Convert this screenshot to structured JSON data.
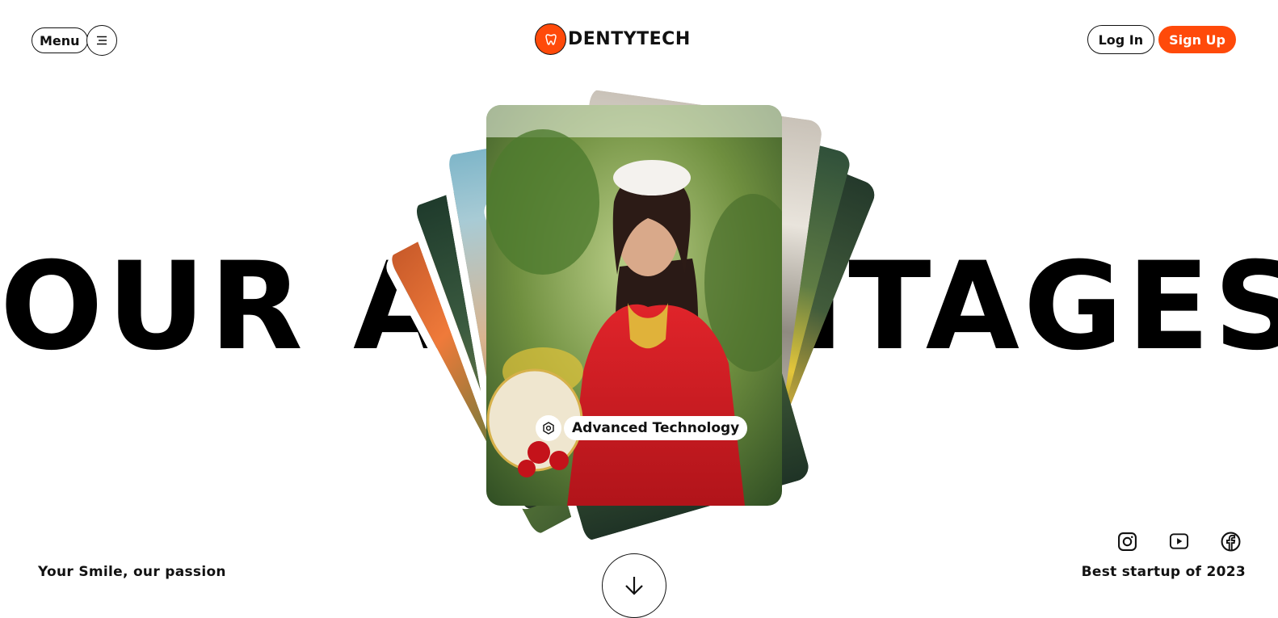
{
  "header": {
    "menu_label": "Menu",
    "menu_icon": "menu-lines-icon",
    "brand_icon": "tooth-icon",
    "brand_name": "DENTYTECH",
    "login_label": "Log In",
    "signup_label": "Sign Up",
    "accent_color": "#ff4a0a"
  },
  "hero": {
    "title": "OUR ADVANTAGES",
    "card_tag_icon": "gear-hex-icon",
    "card_tag_label": "Advanced Technology"
  },
  "footer": {
    "tagline": "Your Smile, our passion",
    "award": "Best startup of 2023",
    "scroll_icon": "arrow-down-icon",
    "social": [
      "instagram-icon",
      "youtube-icon",
      "facebook-icon"
    ]
  }
}
